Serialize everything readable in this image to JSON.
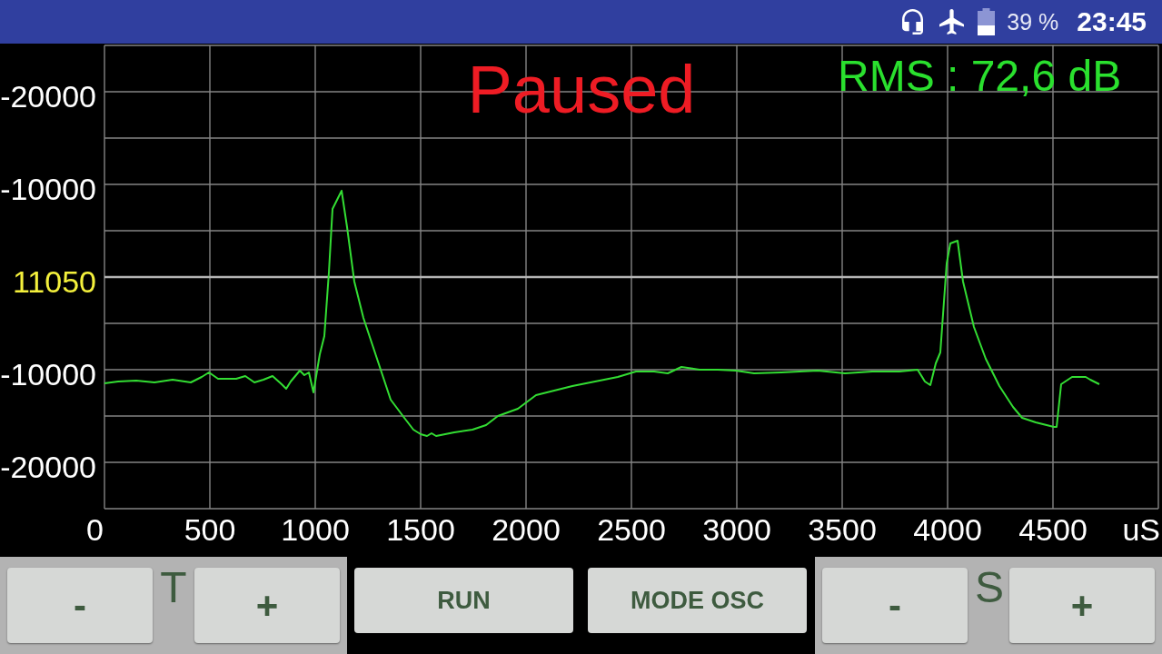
{
  "status_bar": {
    "battery_percent": "39 %",
    "time": "23:45"
  },
  "scope": {
    "state": "Paused",
    "rms": "RMS : 72,6 dB",
    "y_labels": [
      {
        "text": "-20000",
        "color": "#ffffff"
      },
      {
        "text": "-10000",
        "color": "#ffffff"
      },
      {
        "text": "11050",
        "color": "#f4f03c"
      },
      {
        "text": "-10000",
        "color": "#ffffff"
      },
      {
        "text": "-20000",
        "color": "#ffffff"
      }
    ],
    "x_labels": [
      "0",
      "500",
      "1000",
      "1500",
      "2000",
      "2500",
      "3000",
      "3500",
      "4000",
      "4500"
    ],
    "x_unit": "uS"
  },
  "toolbar": [
    {
      "kind": "stepper",
      "label": "T",
      "decrease": "-",
      "increase": "+"
    },
    {
      "kind": "button",
      "label": "RUN"
    },
    {
      "kind": "button",
      "label": "MODE OSC"
    },
    {
      "kind": "stepper",
      "label": "S",
      "decrease": "-",
      "increase": "+"
    }
  ]
}
